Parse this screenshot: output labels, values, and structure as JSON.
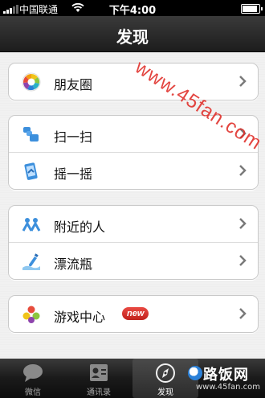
{
  "status": {
    "carrier": "中国联通",
    "time": "下午4:00"
  },
  "nav": {
    "title": "发现"
  },
  "watermark": "www.45fan.com",
  "groups": [
    {
      "items": [
        {
          "label": "朋友圈",
          "icon": "moments-icon"
        }
      ]
    },
    {
      "items": [
        {
          "label": "扫一扫",
          "icon": "scan-icon"
        },
        {
          "label": "摇一摇",
          "icon": "shake-icon"
        }
      ]
    },
    {
      "items": [
        {
          "label": "附近的人",
          "icon": "nearby-people-icon"
        },
        {
          "label": "漂流瓶",
          "icon": "drift-bottle-icon"
        }
      ]
    },
    {
      "items": [
        {
          "label": "游戏中心",
          "icon": "games-icon",
          "badge": "new"
        }
      ]
    }
  ],
  "tabs": [
    {
      "label": "微信",
      "icon": "chat-bubble-icon"
    },
    {
      "label": "通讯录",
      "icon": "contacts-icon"
    },
    {
      "label": "发现",
      "icon": "compass-icon",
      "active": true
    }
  ],
  "logo": {
    "text": "路饭网",
    "url": "www.45fan.com"
  },
  "colors": {
    "accent": "#2a80d8",
    "badge": "#d3302a",
    "watermark": "#e0312c"
  }
}
